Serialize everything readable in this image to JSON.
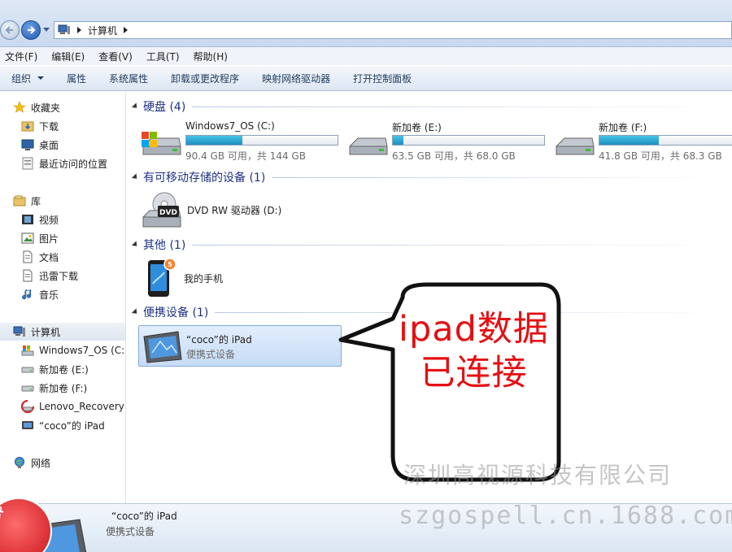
{
  "address": {
    "crumb": "计算机"
  },
  "menu": [
    "文件(F)",
    "编辑(E)",
    "查看(V)",
    "工具(T)",
    "帮助(H)"
  ],
  "toolbar": {
    "organize": "组织",
    "items": [
      "属性",
      "系统属性",
      "卸载或更改程序",
      "映射网络驱动器",
      "打开控制面板"
    ]
  },
  "sidebar": {
    "favorites": {
      "label": "收藏夹",
      "items": [
        "下载",
        "桌面",
        "最近访问的位置"
      ]
    },
    "library": {
      "label": "库",
      "items": [
        "视频",
        "图片",
        "文档",
        "迅雷下载",
        "音乐"
      ]
    },
    "computer": {
      "label": "计算机",
      "items": [
        "Windows7_OS (C:)",
        "新加卷 (E:)",
        "新加卷 (F:)",
        "Lenovo_Recovery (",
        "“coco”的 iPad"
      ]
    },
    "network": {
      "label": "网络"
    }
  },
  "groups": {
    "hdd": {
      "title": "硬盘 (4)"
    },
    "removable": {
      "title": "有可移动存储的设备 (1)"
    },
    "other": {
      "title": "其他 (1)"
    },
    "portable": {
      "title": "便携设备 (1)"
    }
  },
  "drives": [
    {
      "name": "Windows7_OS (C:)",
      "free": "90.4 GB 可用，共 144 GB",
      "used_fraction": 0.37
    },
    {
      "name": "新加卷 (E:)",
      "free": "63.5 GB 可用，共 68.0 GB",
      "used_fraction": 0.07
    },
    {
      "name": "新加卷 (F:)",
      "free": "41.8 GB 可用，共 68.3 GB",
      "used_fraction": 0.39
    }
  ],
  "dvd": {
    "name": "DVD RW 驱动器 (D:)",
    "icon_text": "DVD"
  },
  "phone": {
    "name": "我的手机"
  },
  "ipad": {
    "name": "“coco”的 iPad",
    "type": "便携式设备"
  },
  "callout": {
    "text": "ipad数据已连接"
  },
  "watermark": {
    "company": "深圳高视源科技有限公司",
    "url": "szgospell.cn.1688.com"
  },
  "details": {
    "name": "“coco”的 iPad",
    "type": "便携式设备",
    "badge": "eTap"
  },
  "colors": {
    "group_title": "#1e3287",
    "callout_red": "#e50f12",
    "drive_fill": "#1d8fc1"
  }
}
